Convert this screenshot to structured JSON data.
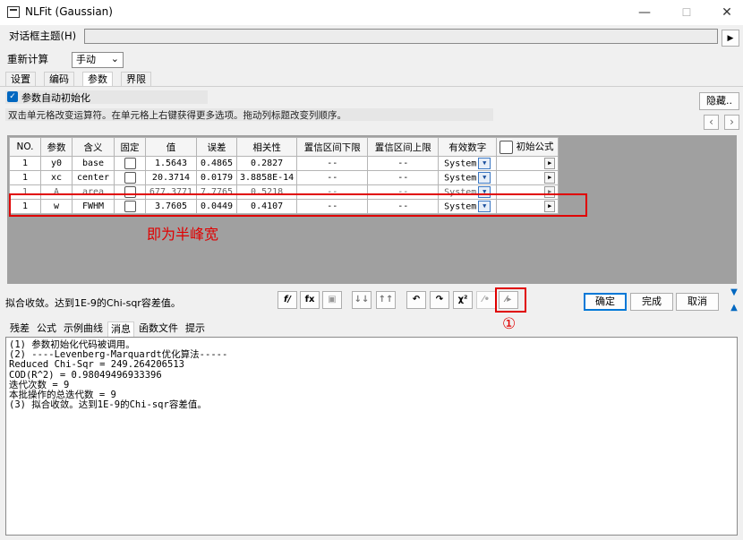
{
  "window": {
    "title": "NLFit (Gaussian)",
    "minimize": "—",
    "maximize": "☐",
    "close": "✕"
  },
  "dialog_theme": {
    "label": "对话框主题(H)",
    "play": "▶"
  },
  "recalc": {
    "label": "重新计算",
    "value": "手动",
    "arrow": "⌄"
  },
  "tabs": [
    {
      "label": "设置"
    },
    {
      "label": "编码"
    },
    {
      "label": "参数"
    },
    {
      "label": "界限"
    }
  ],
  "auto_init": {
    "label": "参数自动初始化",
    "checked": true
  },
  "hint": "双击单元格改变运算符。在单元格上右键获得更多选项。拖动列标题改变列顺序。",
  "hide_button": "隐藏..",
  "nav": {
    "prev": "‹",
    "next": "›"
  },
  "table": {
    "headers": [
      "NO.",
      "参数",
      "含义",
      "固定",
      "值",
      "误差",
      "相关性",
      "置信区间下限",
      "置信区间上限",
      "有效数字",
      "初始公式"
    ],
    "rows": [
      {
        "no": "1",
        "param": "y0",
        "meaning": "base",
        "value": "1.5643",
        "error": "0.4865",
        "corr": "0.2827",
        "lcl": "--",
        "ucl": "--",
        "sig": "System"
      },
      {
        "no": "1",
        "param": "xc",
        "meaning": "center",
        "value": "20.3714",
        "error": "0.0179",
        "corr": "3.8858E-14",
        "lcl": "--",
        "ucl": "--",
        "sig": "System"
      },
      {
        "no": "1",
        "param": "A",
        "meaning": "area",
        "value": "677.3771",
        "error": "7.7765",
        "corr": "0.5218",
        "lcl": "--",
        "ucl": "--",
        "sig": "System"
      },
      {
        "no": "1",
        "param": "w",
        "meaning": "FWHM",
        "value": "3.7605",
        "error": "0.0449",
        "corr": "0.4107",
        "lcl": "--",
        "ucl": "--",
        "sig": "System"
      }
    ]
  },
  "annotation": {
    "text": "即为半峰宽",
    "circle": "①"
  },
  "status": "拟合收敛。达到1E-9的Chi-sqr容差值。",
  "tools": [
    "f/",
    "fx",
    "▣",
    "↓↓",
    "↑↑",
    "↶",
    "↷",
    "χ²",
    "⁄•",
    "⁄▸"
  ],
  "buttons": {
    "ok": "确定",
    "done": "完成",
    "cancel": "取消"
  },
  "bottom_tabs": [
    "残差",
    "公式",
    "示例曲线",
    "消息",
    "函数文件",
    "提示"
  ],
  "log_lines": [
    "(1) 参数初始化代码被调用。",
    "(2) ----Levenberg-Marquardt优化算法-----",
    "Reduced Chi-Sqr = 249.264206513",
    "COD(R^2) = 0.98049496933396",
    "迭代次数 = 9",
    "本批操作的总迭代数 = 9",
    "(3) 拟合收敛。达到1E-9的Chi-sqr容差值。"
  ],
  "colors": {
    "highlight": "#e00000",
    "accent": "#0078d7",
    "grid_bg": "#a0a0a0"
  }
}
